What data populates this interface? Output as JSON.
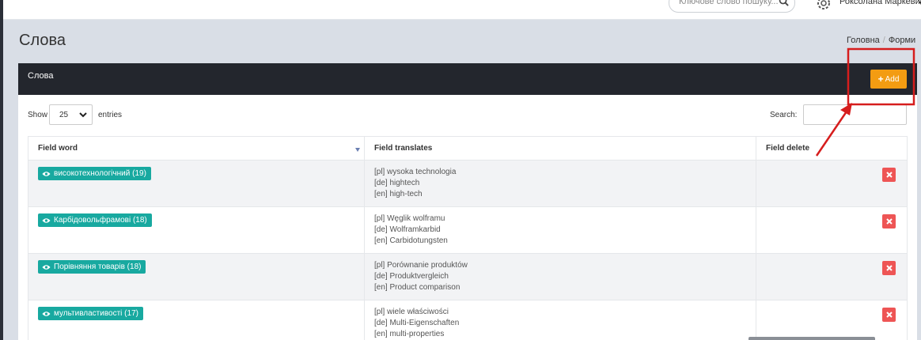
{
  "topbar": {
    "search_placeholder": "Ключове слово пошуку...",
    "user_name": "Роксолана Маркевич"
  },
  "page": {
    "title": "Слова",
    "breadcrumb": [
      "Головна",
      "Форми"
    ]
  },
  "card": {
    "title": "Слова",
    "add_label": "Add"
  },
  "controls": {
    "show_label": "Show",
    "page_length": "25",
    "entries_label": "entries",
    "search_label": "Search:"
  },
  "table": {
    "columns": [
      "Field word",
      "Field translates",
      "Field delete"
    ],
    "rows": [
      {
        "word": "високотехнологічний (19)",
        "translates": [
          "[pl] wysoka technologia",
          "[de] hightech",
          "[en] high-tech"
        ]
      },
      {
        "word": "Карбідовольфрамові (18)",
        "translates": [
          "[pl] Węglik wolframu",
          "[de] Wolframkarbid",
          "[en] Carbidotungsten"
        ]
      },
      {
        "word": "Порівняння товарів (18)",
        "translates": [
          "[pl] Porównanie produktów",
          "[de] Produktvergleich",
          "[en] Product comparison"
        ]
      },
      {
        "word": "мультивластивості (17)",
        "translates": [
          "[pl] wiele właściwości",
          "[de] Multi-Eigenschaften",
          "[en] multi-properties"
        ]
      }
    ]
  },
  "colors": {
    "header_dark": "#23262d",
    "add_orange": "#f39c12",
    "badge_teal": "#18a9a0",
    "delete_red": "#ee5555",
    "annotation_red": "#d61d1d"
  }
}
